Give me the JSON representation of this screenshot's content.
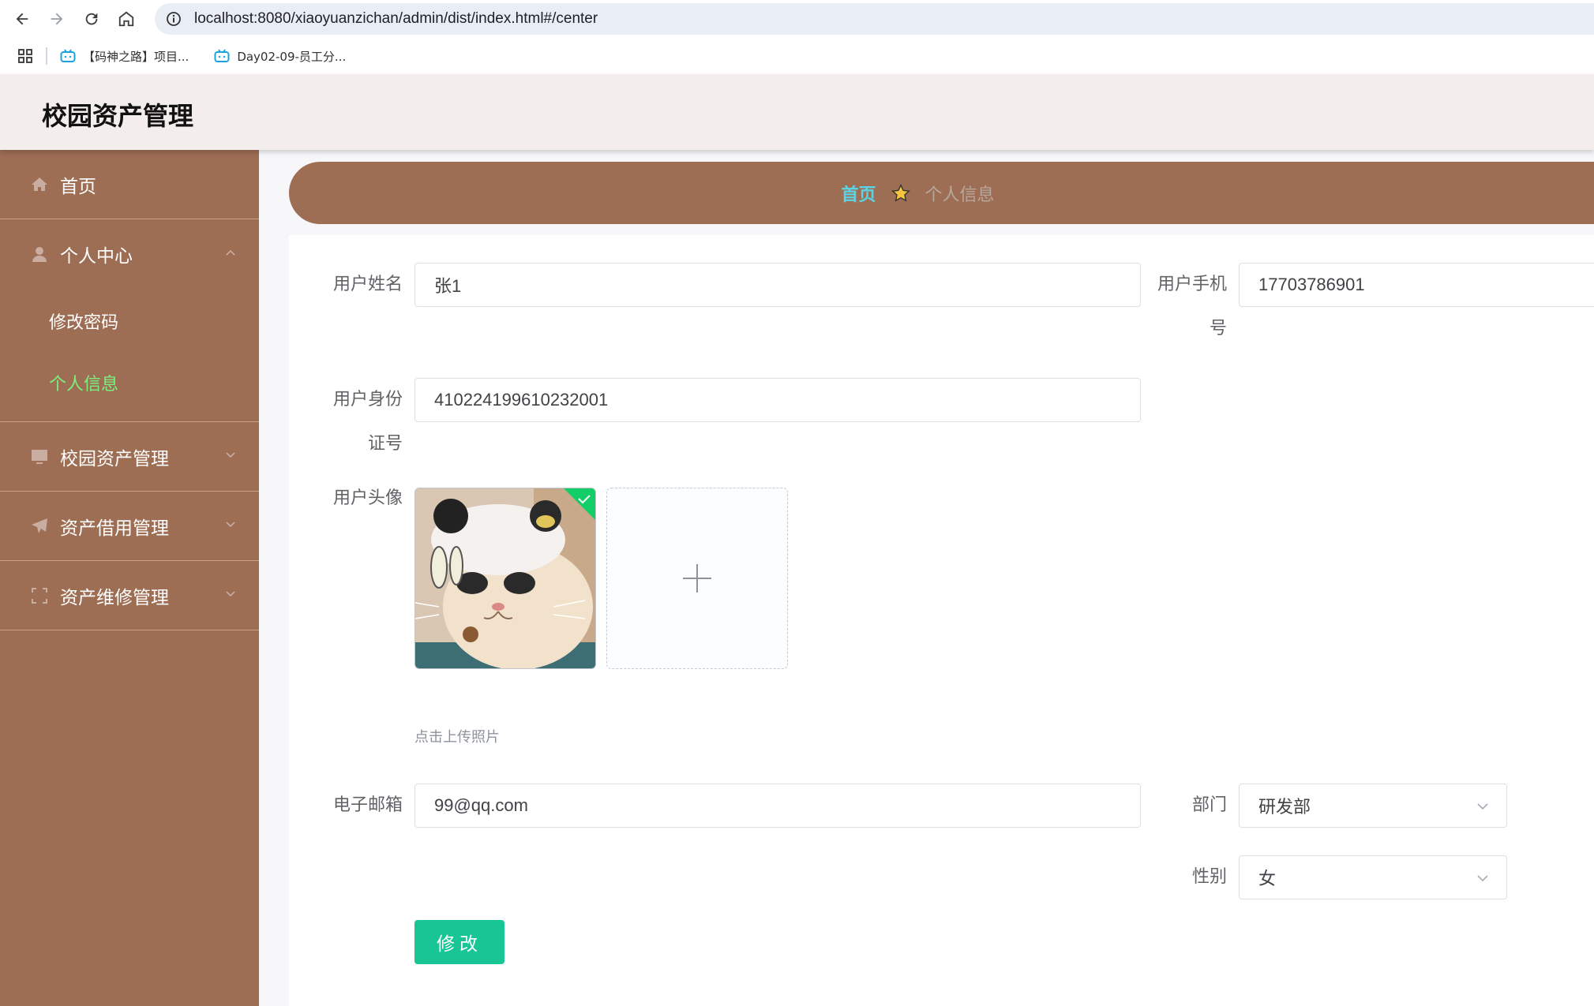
{
  "browser": {
    "url": "localhost:8080/xiaoyuanzichan/admin/dist/index.html#/center",
    "bookmarks": [
      {
        "label": "【码神之路】项目..."
      },
      {
        "label": "Day02-09-员工分..."
      }
    ]
  },
  "header": {
    "title": "校园资产管理"
  },
  "sidebar": {
    "home": {
      "label": "首页",
      "icon": "home-icon"
    },
    "personal_center": {
      "label": "个人中心",
      "icon": "user-icon",
      "sub": [
        {
          "label": "修改密码"
        },
        {
          "label": "个人信息",
          "active": true
        }
      ]
    },
    "asset_mgmt": {
      "label": "校园资产管理",
      "icon": "monitor-icon"
    },
    "borrow_mgmt": {
      "label": "资产借用管理",
      "icon": "send-icon"
    },
    "repair_mgmt": {
      "label": "资产维修管理",
      "icon": "scan-icon"
    }
  },
  "breadcrumb": {
    "home": "首页",
    "current": "个人信息"
  },
  "form": {
    "name": {
      "label": "用户姓名",
      "value": "张1"
    },
    "phone": {
      "label_line1": "用户手机",
      "label_line2": "号",
      "value": "17703786901"
    },
    "id_card": {
      "label_line1": "用户身份",
      "label_line2": "证号",
      "value": "410224199610232001"
    },
    "avatar": {
      "label": "用户头像",
      "hint": "点击上传照片"
    },
    "email": {
      "label": "电子邮箱",
      "value": "99@qq.com"
    },
    "department": {
      "label": "部门",
      "value": "研发部"
    },
    "gender": {
      "label": "性别",
      "value": "女"
    },
    "submit_label": "修改"
  },
  "colors": {
    "sidebar_bg": "#9d6d54",
    "header_bg": "#f3eeec",
    "active_menu": "#7cf07f",
    "breadcrumb_home": "#59d4e6",
    "primary_button": "#18c594"
  }
}
